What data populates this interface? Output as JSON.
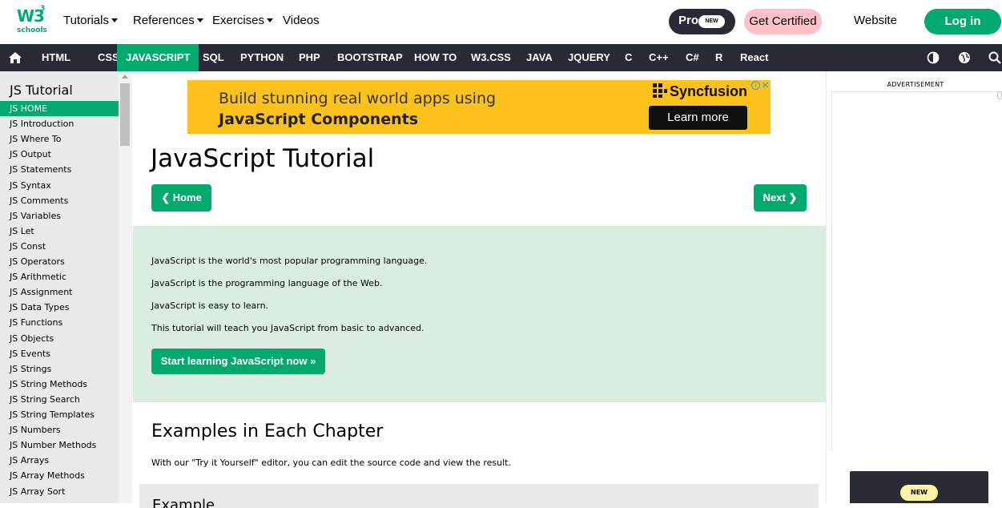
{
  "brand": {
    "logo_text": "W3",
    "logo_sup": "3",
    "logo_sub": "schools"
  },
  "topnav": {
    "tutorials": "Tutorials",
    "references": "References",
    "exercises": "Exercises",
    "videos": "Videos",
    "pro": "Pro",
    "pro_badge": "NEW",
    "get_certified": "Get Certified",
    "website": "Website",
    "login": "Log in"
  },
  "darknav": {
    "items": [
      "HTML",
      "CSS",
      "JAVASCRIPT",
      "SQL",
      "PYTHON",
      "PHP",
      "BOOTSTRAP",
      "HOW TO",
      "W3.CSS",
      "JAVA",
      "JQUERY",
      "C",
      "C++",
      "C#",
      "R",
      "React"
    ],
    "active": "JAVASCRIPT"
  },
  "sidebar": {
    "title": "JS Tutorial",
    "items": [
      "JS HOME",
      "JS Introduction",
      "JS Where To",
      "JS Output",
      "JS Statements",
      "JS Syntax",
      "JS Comments",
      "JS Variables",
      "JS Let",
      "JS Const",
      "JS Operators",
      "JS Arithmetic",
      "JS Assignment",
      "JS Data Types",
      "JS Functions",
      "JS Objects",
      "JS Events",
      "JS Strings",
      "JS String Methods",
      "JS String Search",
      "JS String Templates",
      "JS Numbers",
      "JS Number Methods",
      "JS Arrays",
      "JS Array Methods",
      "JS Array Sort"
    ],
    "active": "JS HOME"
  },
  "ad_banner": {
    "line1": "Build stunning real world apps using",
    "line2": "JavaScript Components",
    "brand": "Syncfusion",
    "cta": "Learn more",
    "info": "i",
    "close": "✕"
  },
  "main": {
    "title": "JavaScript Tutorial",
    "prev": "❮ Home",
    "next": "Next ❯",
    "intro": [
      "JavaScript is the world's most popular programming language.",
      "JavaScript is the programming language of the Web.",
      "JavaScript is easy to learn.",
      "This tutorial will teach you JavaScript from basic to advanced."
    ],
    "start_button": "Start learning JavaScript now »",
    "section_title": "Examples in Each Chapter",
    "section_text": "With our \"Try it Yourself\" editor, you can edit the source code and view the result.",
    "example_title": "Example"
  },
  "right": {
    "ad_label": "ADVERTISEMENT",
    "promo_badge": "NEW"
  },
  "colors": {
    "accent": "#04aa6d",
    "dark": "#282a35",
    "sidebar_bg": "#e7e9eb",
    "intro_bg": "#d9eee1",
    "cert_bg": "#ffc0c7",
    "ad_bg": "#fcc21b"
  }
}
